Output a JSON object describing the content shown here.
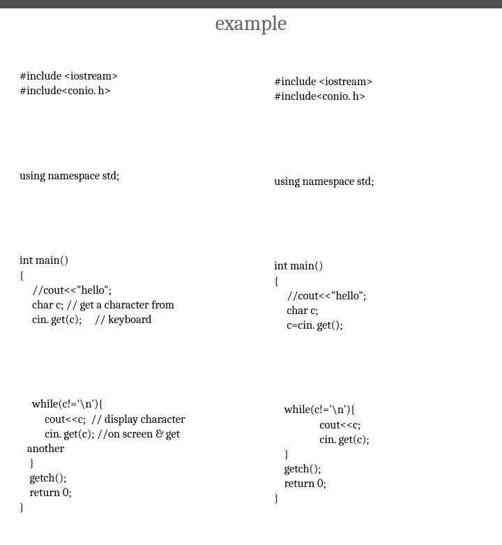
{
  "title": "example",
  "left": {
    "includes": "#include <iostream>\n#include<conio. h>",
    "using": "using namespace std;",
    "main1": "int main()\n{\n     //cout<<\"hello\";\n     char c; // get a character from\n     cin. get(c);     // keyboard",
    "main2": "     while(c!='\\n'){\n          cout<<c;  // display character\n          cin. get(c); //on screen & get\n   another\n    }\n    getch();\n    return 0;\n}"
  },
  "right": {
    "includes": "#include <iostream>\n#include<conio. h>",
    "using": "using namespace std;",
    "main1": "int main()\n{\n     //cout<<\"hello\";\n     char c;\n     c=cin. get();",
    "main2": "    while(c!='\\n'){\n                  cout<<c;\n                  cin. get(c);\n    }\n    getch();\n    return 0;\n}"
  }
}
